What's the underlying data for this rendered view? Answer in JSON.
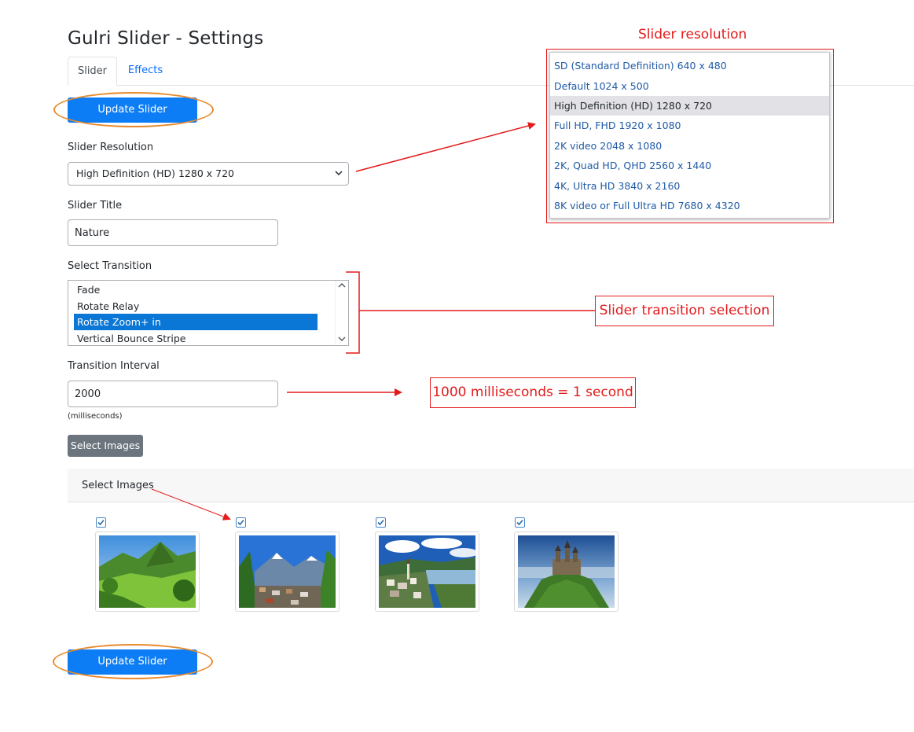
{
  "page": {
    "title": "Gulri Slider - Settings"
  },
  "tabs": [
    {
      "label": "Slider",
      "active": true
    },
    {
      "label": "Effects",
      "active": false
    }
  ],
  "buttons": {
    "update_top": "Update Slider",
    "update_bottom": "Update Slider",
    "select_images": "Select Images"
  },
  "form": {
    "resolution": {
      "label": "Slider Resolution",
      "selected": "High Definition (HD) 1280 x 720"
    },
    "title": {
      "label": "Slider Title",
      "value": "Nature"
    },
    "transition": {
      "label": "Select Transition",
      "options": [
        "Fade",
        "Rotate Relay",
        "Rotate Zoom+ in",
        "Vertical Bounce Stripe"
      ],
      "selected": "Rotate Zoom+ in"
    },
    "interval": {
      "label": "Transition Interval",
      "value": "2000",
      "helper": "(milliseconds)"
    }
  },
  "images_section": {
    "header": "Select Images",
    "images": [
      {
        "icon": "mountain-meadow-photo",
        "checked": true
      },
      {
        "icon": "alpine-village-photo",
        "checked": true
      },
      {
        "icon": "lakeside-town-photo",
        "checked": true
      },
      {
        "icon": "hilltop-castle-photo",
        "checked": true
      }
    ]
  },
  "resolution_dropdown": {
    "options": [
      "SD (Standard Definition) 640 x 480",
      "Default 1024 x 500",
      "High Definition (HD) 1280 x 720",
      "Full HD, FHD 1920 x 1080",
      "2K video 2048 x 1080",
      "2K, Quad HD, QHD 2560 x 1440",
      "4K, Ultra HD 3840 x 2160",
      "8K video or Full Ultra HD 7680 x 4320"
    ],
    "highlighted": "High Definition (HD) 1280 x 720"
  },
  "annotations": {
    "resolution": "Slider resolution",
    "transition": "Slider transition selection",
    "interval": "1000 milliseconds = 1 second"
  },
  "colors": {
    "primary": "#0d7df5",
    "annotation": "#e31b1b",
    "highlight_ellipse": "#e88a2c"
  }
}
